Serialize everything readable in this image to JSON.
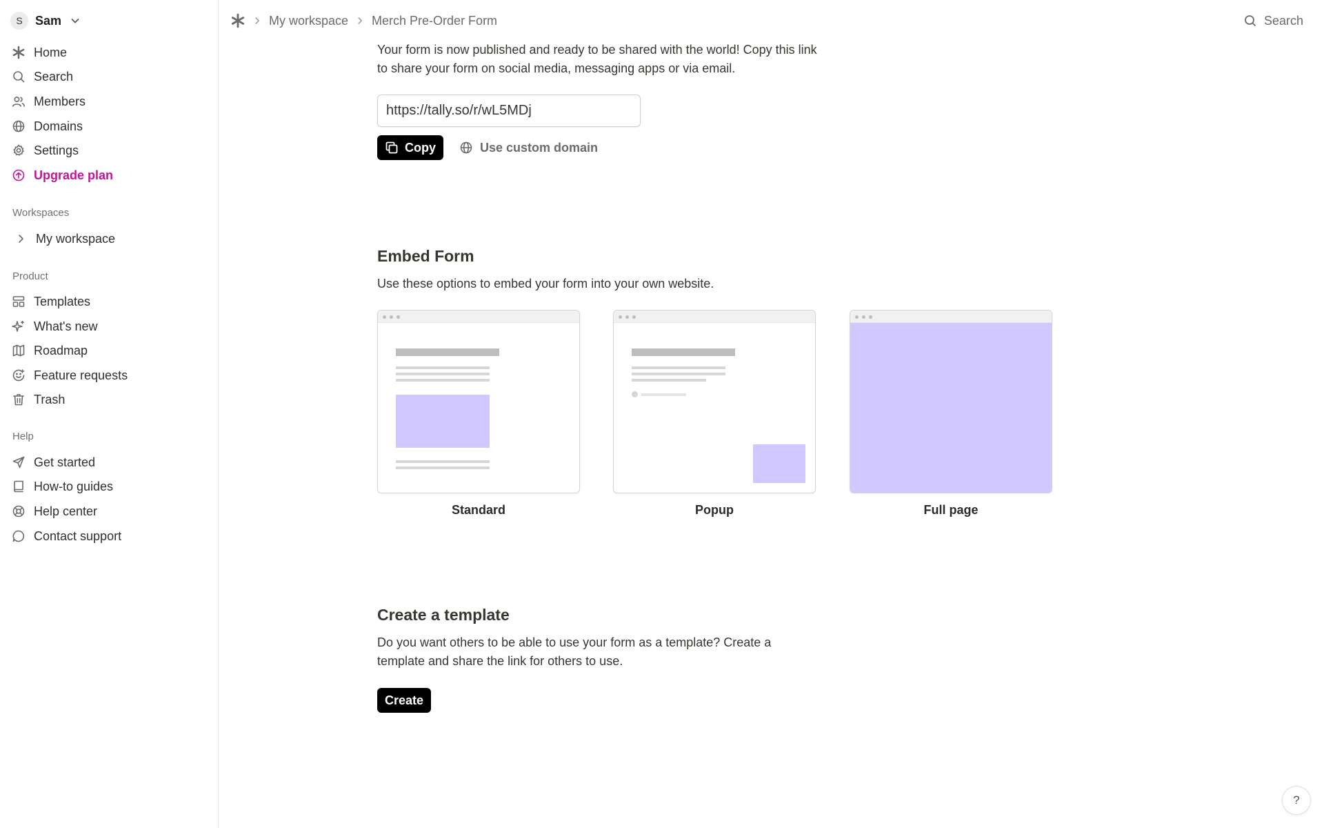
{
  "user": {
    "initial": "S",
    "name": "Sam"
  },
  "sidebar": {
    "main": [
      {
        "label": "Home",
        "icon": "tally-logo-icon"
      },
      {
        "label": "Search",
        "icon": "search-icon"
      },
      {
        "label": "Members",
        "icon": "members-icon"
      },
      {
        "label": "Domains",
        "icon": "globe-icon"
      },
      {
        "label": "Settings",
        "icon": "gear-icon"
      },
      {
        "label": "Upgrade plan",
        "icon": "upgrade-icon"
      }
    ],
    "workspaces_label": "Workspaces",
    "workspaces": [
      {
        "label": "My workspace"
      }
    ],
    "product_label": "Product",
    "product": [
      {
        "label": "Templates",
        "icon": "templates-icon"
      },
      {
        "label": "What's new",
        "icon": "sparkle-icon"
      },
      {
        "label": "Roadmap",
        "icon": "map-icon"
      },
      {
        "label": "Feature requests",
        "icon": "feature-request-icon"
      },
      {
        "label": "Trash",
        "icon": "trash-icon"
      }
    ],
    "help_label": "Help",
    "help": [
      {
        "label": "Get started",
        "icon": "paper-plane-icon"
      },
      {
        "label": "How-to guides",
        "icon": "book-icon"
      },
      {
        "label": "Help center",
        "icon": "lifebuoy-icon"
      },
      {
        "label": "Contact support",
        "icon": "chat-icon"
      }
    ]
  },
  "topbar": {
    "breadcrumb": [
      "My workspace",
      "Merch Pre-Order Form"
    ],
    "search_label": "Search"
  },
  "share": {
    "description": "Your form is now published and ready to be shared with the world! Copy this link to share your form on social media, messaging apps or via email.",
    "url": "https://tally.so/r/wL5MDj",
    "copy_label": "Copy",
    "custom_domain_label": "Use custom domain"
  },
  "embed": {
    "title": "Embed Form",
    "description": "Use these options to embed your form into your own website.",
    "options": [
      {
        "label": "Standard"
      },
      {
        "label": "Popup"
      },
      {
        "label": "Full page"
      }
    ],
    "accent_color": "#d0c8ff"
  },
  "template": {
    "title": "Create a template",
    "description": "Do you want others to be able to use your form as a template? Create a template and share the link for others to use.",
    "create_label": "Create"
  },
  "help_fab": {
    "label": "?"
  }
}
